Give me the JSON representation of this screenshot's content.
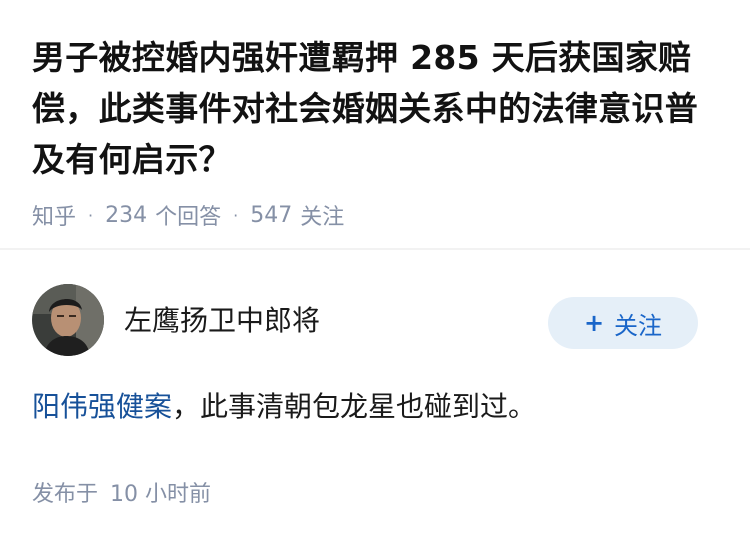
{
  "question": {
    "title": "男子被控婚内强奸遭羁押 285 天后获国家赔偿，此类事件对社会婚姻关系中的法律意识普及有何启示？",
    "source": "知乎",
    "answer_count": "234",
    "answer_unit": "个回答",
    "follow_count": "547",
    "follow_unit": "关注"
  },
  "answer": {
    "author_name": "左鹰扬卫中郎将",
    "follow_button_label": "关注",
    "follow_button_icon": "plus-icon",
    "content_link_text": "阳伟强健案",
    "content_rest": "，此事清朝包龙星也碰到过。",
    "publish_label": "发布于",
    "publish_time": "10 小时前"
  },
  "colors": {
    "link": "#175199",
    "meta": "#8590a6",
    "follow_bg": "#e5eff8",
    "follow_text": "#1a66c9"
  }
}
